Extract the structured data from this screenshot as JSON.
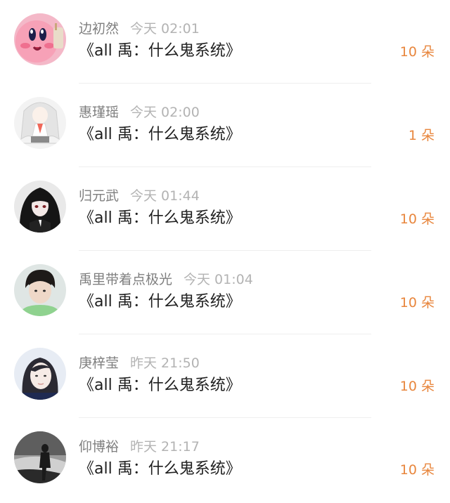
{
  "gifts": [
    {
      "user": "边初然",
      "time": "今天 02:01",
      "title": "《all 禹：什么鬼系统》",
      "flowers": "10 朵",
      "avatar_icon": "kirby-avatar-icon"
    },
    {
      "user": "惠瑾瑶",
      "time": "今天 02:00",
      "title": "《all 禹：什么鬼系统》",
      "flowers": "1 朵",
      "avatar_icon": "anime-girl-avatar-icon"
    },
    {
      "user": "归元武",
      "time": "今天 01:44",
      "title": "《all 禹：什么鬼系统》",
      "flowers": "10 朵",
      "avatar_icon": "dark-anime-avatar-icon"
    },
    {
      "user": "禹里带着点极光",
      "time": "今天 01:04",
      "title": "《all 禹：什么鬼系统》",
      "flowers": "10 朵",
      "avatar_icon": "boy-photo-avatar-icon"
    },
    {
      "user": "庚梓莹",
      "time": "昨天 21:50",
      "title": "《all 禹：什么鬼系统》",
      "flowers": "10 朵",
      "avatar_icon": "girl-photo-avatar-icon"
    },
    {
      "user": "仰博裕",
      "time": "昨天 21:17",
      "title": "《all 禹：什么鬼系统》",
      "flowers": "10 朵",
      "avatar_icon": "silhouette-avatar-icon"
    }
  ],
  "colors": {
    "accent": "#e8863d",
    "username": "#7f7f7f",
    "time": "#b3b3b3",
    "title": "#1f1f1f",
    "divider": "#eeeeee"
  }
}
